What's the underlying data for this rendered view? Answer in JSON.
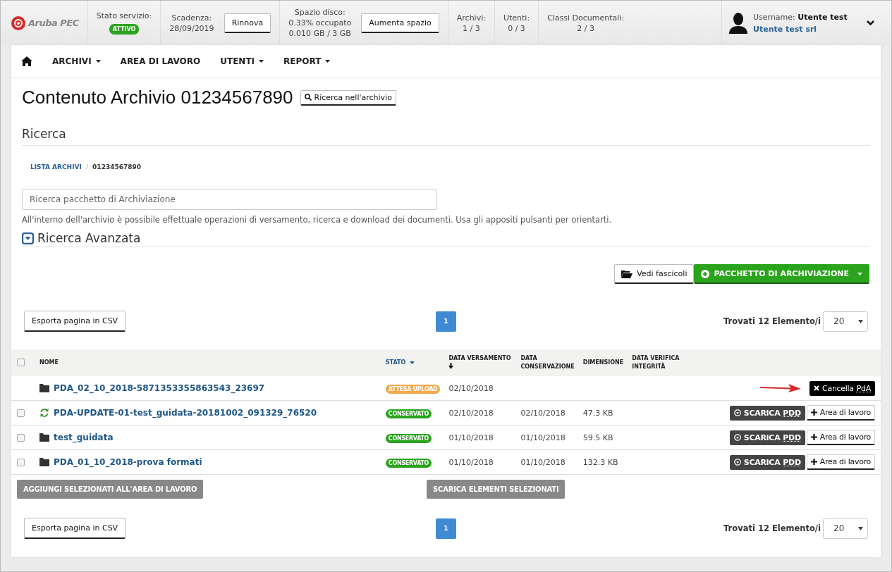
{
  "header": {
    "brand": "Aruba PEC",
    "stats": [
      {
        "label": "Stato servizio:",
        "badge": "ATTIVO"
      },
      {
        "label": "Scadenza:",
        "lines": [
          "28/09/2019"
        ],
        "button": "Rinnova"
      },
      {
        "label": "Spazio disco:",
        "lines": [
          "0.33% occupato",
          "0.010 GB / 3 GB"
        ],
        "button": "Aumenta spazio"
      },
      {
        "label": "Archivi:",
        "lines": [
          "1 / 3"
        ]
      },
      {
        "label": "Utenti:",
        "lines": [
          "0 / 3"
        ]
      },
      {
        "label": "Classi Documentali:",
        "lines": [
          "2 / 3"
        ]
      }
    ],
    "user": {
      "username": "Username: **Utente test**",
      "company": "Utente test srl"
    }
  },
  "nav": [
    {
      "label": "ARCHIVI",
      "dropdown": true
    },
    {
      "label": "AREA DI LAVORO",
      "dropdown": false
    },
    {
      "label": "UTENTI",
      "dropdown": true
    },
    {
      "label": "REPORT",
      "dropdown": true
    }
  ],
  "page": {
    "title": "Contenuto Archivio 01234567890",
    "title_button": "Ricerca nell'archivio",
    "section": "Ricerca",
    "breadcrumb": [
      "LISTA ARCHIVI",
      "01234567890"
    ],
    "breadcrumb_separator": "/",
    "search": {
      "placeholder": "Ricerca pacchetto di Archiviazione"
    },
    "help": "All'interno dell'archivio è possibile effettuale operazioni di versamento, ricerca e download dei documenti. Usa gli appositi pulsanti per orientarti.",
    "advanced": "Ricerca Avanzata",
    "actions": [
      {
        "kind": "folder",
        "label": "Vedi fascicoli"
      },
      {
        "kind": "create",
        "label": "PACCHETTO DI ARCHIVIAZIONE"
      }
    ]
  },
  "pager_top": {
    "export": "Esporta pagina in CSV",
    "pages": [
      {
        "label": "1",
        "selected": true
      }
    ],
    "count": "Trovati 12 Elemento/i",
    "page_size": "20"
  },
  "table": {
    "select_all_checked": false,
    "columns": [
      {
        "label": "NOME",
        "kind": "plain"
      },
      {
        "label": "STATO",
        "kind": "menu"
      },
      {
        "label": "DATA VERSAMENTO",
        "kind": "sorted"
      },
      {
        "label": "DATA CONSERVAZIONE",
        "kind": "plain"
      },
      {
        "label": "DIMENSIONE",
        "kind": "plain"
      },
      {
        "label": "DATA VERIFICA INTEGRITÀ",
        "kind": "plain"
      }
    ],
    "rows": [
      {
        "name": "PDA_02_10_2018-5871353355863543_23697",
        "kind": "folder",
        "has_checkbox": false,
        "status": "ATTESA UPLOAD",
        "color": "#f3a94a",
        "data_versamento": "02/10/2018",
        "pointer_arrow": true,
        "actions": [
          {
            "kind": "delete",
            "label": "Cancella",
            "abbr": "PdA"
          }
        ]
      },
      {
        "name": "PDA-UPDATE-01-test_guidata-20181002_091329_76520",
        "kind": "sync",
        "has_checkbox": true,
        "checked": false,
        "status": "CONSERVATO",
        "color": "#2aa31d",
        "data_versamento": "02/10/2018",
        "data_conservazione": "02/10/2018",
        "dimensione": "47.3 KB",
        "pointer_arrow": false,
        "actions": [
          {
            "kind": "download",
            "label": "SCARICA",
            "abbr": "PDD"
          },
          {
            "kind": "add",
            "label": "Area di lavoro"
          }
        ]
      },
      {
        "name": "test_guidata",
        "kind": "folder",
        "has_checkbox": true,
        "checked": false,
        "status": "CONSERVATO",
        "color": "#2aa31d",
        "data_versamento": "01/10/2018",
        "data_conservazione": "01/10/2018",
        "dimensione": "59.5 KB",
        "pointer_arrow": false,
        "actions": [
          {
            "kind": "download",
            "label": "SCARICA",
            "abbr": "PDD"
          },
          {
            "kind": "add",
            "label": "Area di lavoro"
          }
        ]
      },
      {
        "name": "PDA_01_10_2018-prova formati",
        "kind": "folder",
        "has_checkbox": true,
        "checked": false,
        "status": "CONSERVATO",
        "color": "#2aa31d",
        "data_versamento": "01/10/2018",
        "data_conservazione": "01/10/2018",
        "dimensione": "132.3 KB",
        "pointer_arrow": false,
        "actions": [
          {
            "kind": "download",
            "label": "SCARICA",
            "abbr": "PDD"
          },
          {
            "kind": "add",
            "label": "Area di lavoro"
          }
        ]
      }
    ]
  },
  "bulk_actions": [
    {
      "label": "AGGIUNGI SELEZIONATI ALL'AREA DI LAVORO",
      "disabled": true
    },
    {
      "label": "SCARICA ELEMENTI SELEZIONATI",
      "disabled": true
    }
  ],
  "pager_bottom": {
    "export": "Esporta pagina in CSV",
    "pages": [
      {
        "label": "1",
        "selected": true
      }
    ],
    "count": "Trovati 12 Elemento/i",
    "page_size": "20"
  }
}
